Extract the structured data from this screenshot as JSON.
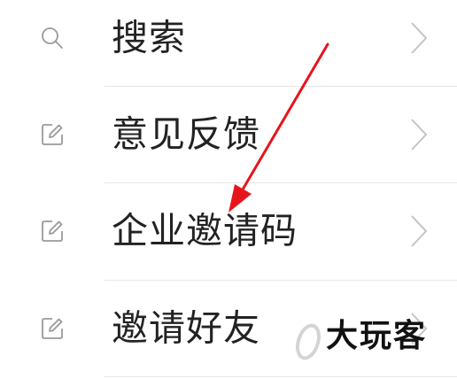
{
  "menu": {
    "items": [
      {
        "label": "搜索",
        "icon": "search-icon"
      },
      {
        "label": "意见反馈",
        "icon": "edit-icon"
      },
      {
        "label": "企业邀请码",
        "icon": "edit-icon"
      },
      {
        "label": "邀请好友",
        "icon": "edit-icon"
      }
    ]
  },
  "watermark": {
    "text": "大玩客"
  },
  "colors": {
    "label": "#222222",
    "icon": "#9a9a9a",
    "chevron": "#c4c4c4",
    "divider": "#e6e6e6",
    "annotation_arrow": "#e8141c"
  }
}
